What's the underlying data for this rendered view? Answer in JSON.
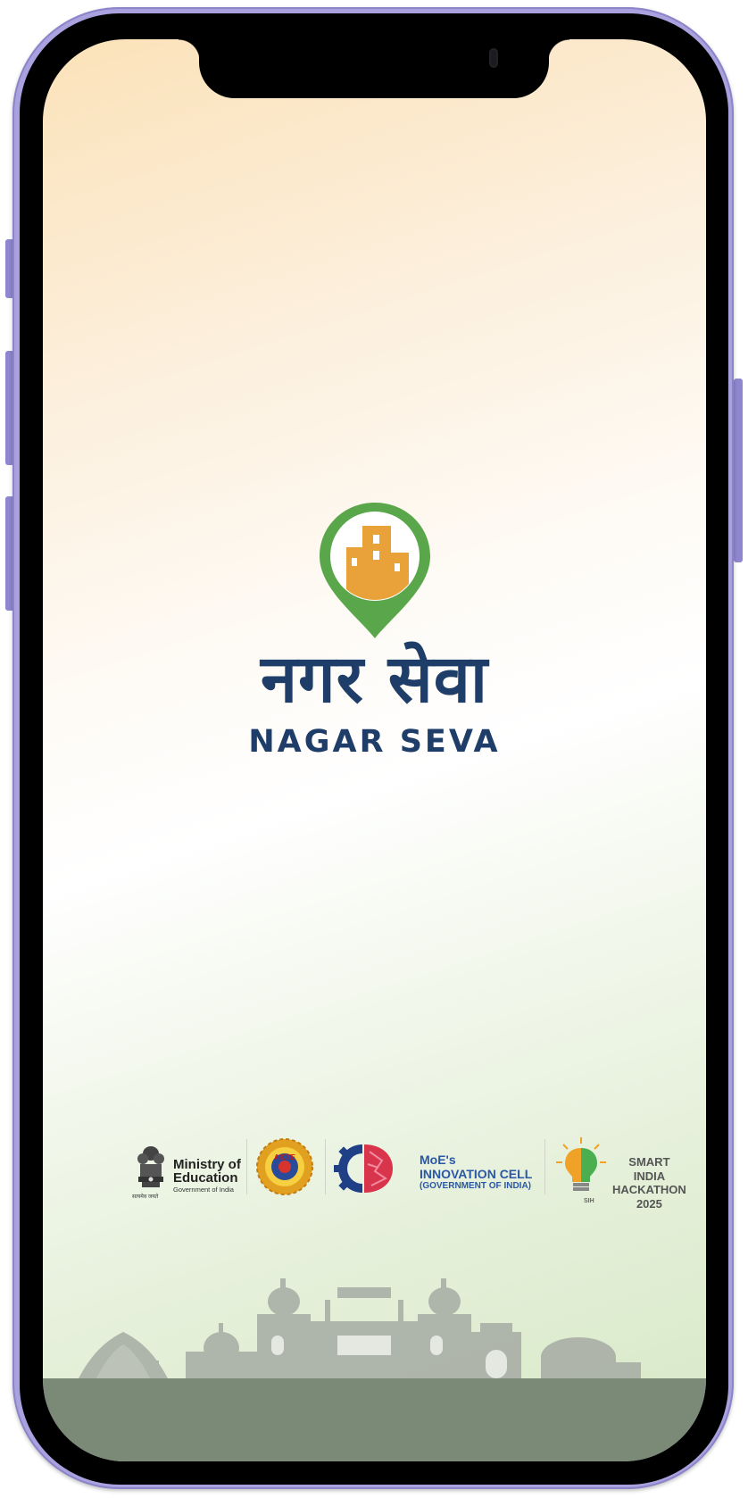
{
  "app": {
    "title_hindi": "नगर सेवा",
    "title_english": "NAGAR SEVA"
  },
  "sponsors": {
    "ministry": {
      "line1": "Ministry of",
      "line2": "Education",
      "line3": "Government of India",
      "emblem_caption": "सत्यमेव जयते"
    },
    "aicte": {
      "label": "AICTE"
    },
    "innovation_cell": {
      "line1": "MoE's",
      "line2": "INNOVATION CELL",
      "line3": "(GOVERNMENT OF INDIA)"
    },
    "sih": {
      "line1": "SMART INDIA",
      "line2": "HACKATHON",
      "line3": "2025",
      "badge": "SIH"
    }
  },
  "colors": {
    "brand_blue": "#1e3e69",
    "pin_green": "#5aa64a",
    "building_orange": "#e9a23a",
    "ground": "#7a8a77",
    "device_frame": "#a9a2df"
  },
  "icons": {
    "logo": "location-pin-building-icon",
    "emblem": "ashoka-emblem-icon",
    "aicte": "aicte-gear-logo-icon",
    "innovation": "gear-brain-icon",
    "sih": "lightbulb-brain-icon",
    "skyline": "delhi-skyline-illustration"
  }
}
